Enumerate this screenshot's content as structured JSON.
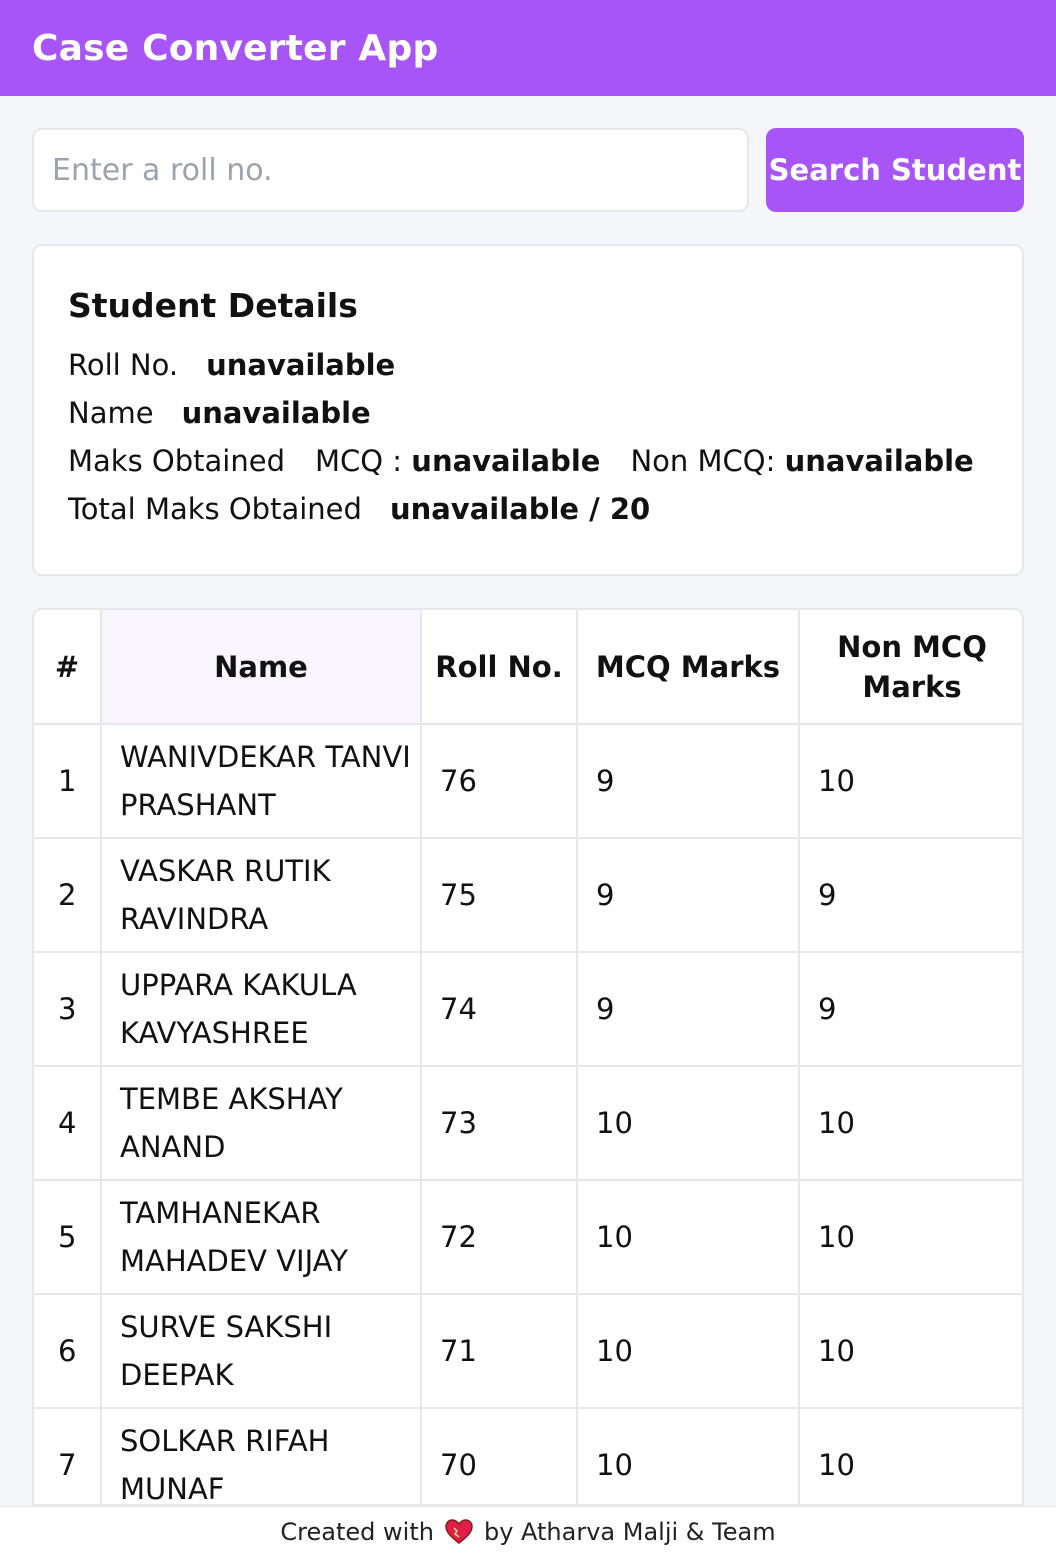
{
  "header": {
    "title": "Case Converter App"
  },
  "search": {
    "placeholder": "Enter a roll no.",
    "value": "",
    "button_label": "Search Student"
  },
  "details": {
    "title": "Student Details",
    "roll_label": "Roll No.",
    "roll_value": "unavailable",
    "name_label": "Name",
    "name_value": "unavailable",
    "marks_label": "Maks Obtained",
    "mcq_label": "MCQ :",
    "mcq_value": "unavailable",
    "nonmcq_label": "Non MCQ:",
    "nonmcq_value": "unavailable",
    "total_label": "Total Maks Obtained",
    "total_value": "unavailable / 20"
  },
  "table": {
    "headers": [
      "#",
      "Name",
      "Roll No.",
      "MCQ Marks",
      "Non MCQ Marks"
    ],
    "rows": [
      {
        "index": "1",
        "name": "WANIVDEKAR TANVI PRASHANT",
        "roll": "76",
        "mcq": "9",
        "nonmcq": "10"
      },
      {
        "index": "2",
        "name": "VASKAR RUTIK RAVINDRA",
        "roll": "75",
        "mcq": "9",
        "nonmcq": "9"
      },
      {
        "index": "3",
        "name": "UPPARA KAKULA KAVYASHREE",
        "roll": "74",
        "mcq": "9",
        "nonmcq": "9"
      },
      {
        "index": "4",
        "name": "TEMBE AKSHAY ANAND",
        "roll": "73",
        "mcq": "10",
        "nonmcq": "10"
      },
      {
        "index": "5",
        "name": "TAMHANEKAR MAHADEV VIJAY",
        "roll": "72",
        "mcq": "10",
        "nonmcq": "10"
      },
      {
        "index": "6",
        "name": "SURVE SAKSHI DEEPAK",
        "roll": "71",
        "mcq": "10",
        "nonmcq": "10"
      },
      {
        "index": "7",
        "name": "SOLKAR RIFAH MUNAF",
        "roll": "70",
        "mcq": "10",
        "nonmcq": "10"
      }
    ]
  },
  "footer": {
    "prefix": "Created with",
    "icon": "heart-icon",
    "suffix": "by Atharva Malji & Team"
  },
  "colors": {
    "accent": "#a855f7",
    "border": "#e5e7eb",
    "background": "#f5f6fa"
  }
}
